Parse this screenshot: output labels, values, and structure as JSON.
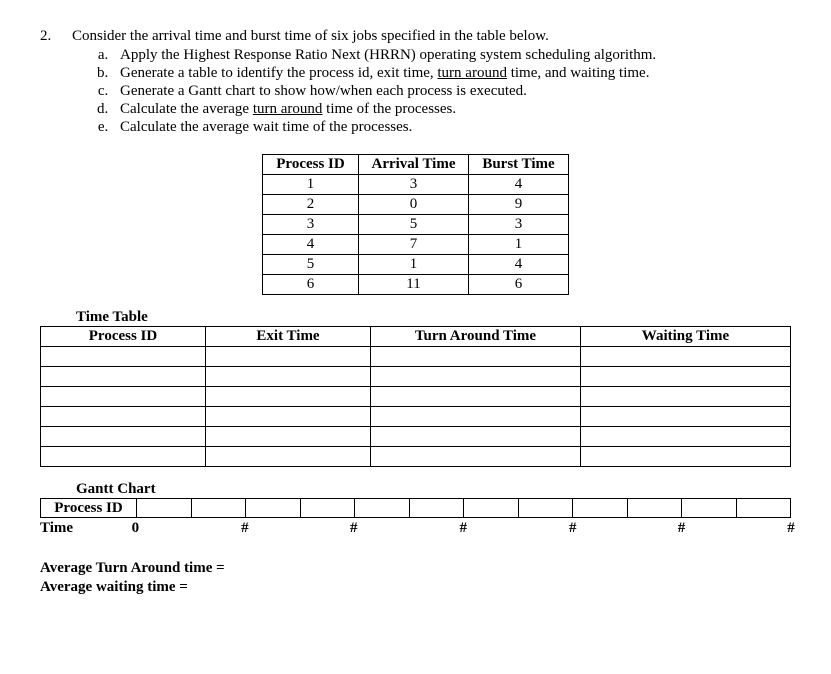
{
  "question": {
    "number": "2.",
    "intro": "Consider the arrival time and burst time of six jobs specified in the table below.",
    "items": {
      "a": "Apply the Highest Response Ratio Next (HRRN) operating system scheduling algorithm.",
      "b_pre": "Generate a table to identify the process id, exit time, ",
      "b_underline": "turn around",
      "b_post": " time, and waiting time.",
      "c": "Generate a Gantt chart to show how/when each process is executed.",
      "d_pre": "Calculate the average ",
      "d_underline": "turn around",
      "d_post": " time of the processes.",
      "e": "Calculate the average wait time of the processes."
    }
  },
  "processTable": {
    "headers": {
      "pid": "Process ID",
      "arrival": "Arrival Time",
      "burst": "Burst Time"
    },
    "rows": [
      {
        "pid": "1",
        "arrival": "3",
        "burst": "4"
      },
      {
        "pid": "2",
        "arrival": "0",
        "burst": "9"
      },
      {
        "pid": "3",
        "arrival": "5",
        "burst": "3"
      },
      {
        "pid": "4",
        "arrival": "7",
        "burst": "1"
      },
      {
        "pid": "5",
        "arrival": "1",
        "burst": "4"
      },
      {
        "pid": "6",
        "arrival": "11",
        "burst": "6"
      }
    ]
  },
  "timeTable": {
    "label": "Time Table",
    "headers": {
      "pid": "Process ID",
      "exit": "Exit Time",
      "tat": "Turn Around Time",
      "wait": "Waiting Time"
    }
  },
  "gantt": {
    "label": "Gantt Chart",
    "rowLabel": "Process ID",
    "timeLabel": "Time",
    "marks": [
      "0",
      "#",
      "#",
      "#",
      "#",
      "#",
      "#"
    ]
  },
  "averages": {
    "tat": "Average Turn Around time =",
    "wait": "Average waiting time ="
  }
}
